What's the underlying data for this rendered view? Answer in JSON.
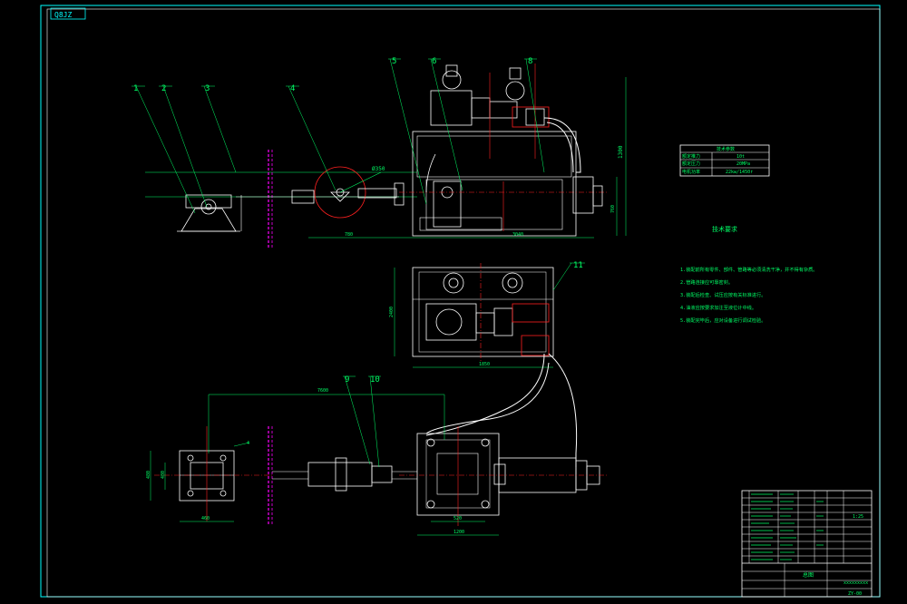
{
  "corner_tag": "Q8JZ",
  "balloons": [
    "1",
    "2",
    "3",
    "4",
    "5",
    "6",
    "8",
    "11",
    "9",
    "10"
  ],
  "dims": {
    "top_overall": "1300",
    "top_left_span": "780",
    "top_mid": "760",
    "top_span": "3040",
    "phi_circle": "Ø350",
    "plan_width": "1850",
    "plan_height": "2400",
    "front_length": "7600",
    "front_small_a": "480",
    "front_small_b": "4",
    "bottom_a": "520",
    "bottom_b": "1200",
    "base_w": "460",
    "base_h": "480"
  },
  "spec_table": {
    "header": "技术参数",
    "rows": [
      [
        "额定推力",
        "10t"
      ],
      [
        "额定压力",
        "20MPa"
      ],
      [
        "电机功率",
        "22kw/1450r"
      ]
    ]
  },
  "notes": {
    "title": "技术要求",
    "items": [
      "1.装配前所有零件、部件、管路等必须清洗干净，并不得有杂质。",
      "2.管路连接应可靠密封。",
      "3.装配后检查、试压应按有关标准进行。",
      "4.油液应按要求加注至液位计中线。",
      "5.装配完毕后，应对设备进行调试检验。"
    ]
  },
  "title_block": {
    "scale": "1:25",
    "drawing_no": "ZY-00",
    "name": "总图",
    "company": "xxxxxxxxx"
  },
  "colors": {
    "frame": "#00ffff",
    "linework": "#ffffff",
    "annotation": "#00ff66",
    "centerline": "#ff2020",
    "hidden": "#ff00ff"
  }
}
